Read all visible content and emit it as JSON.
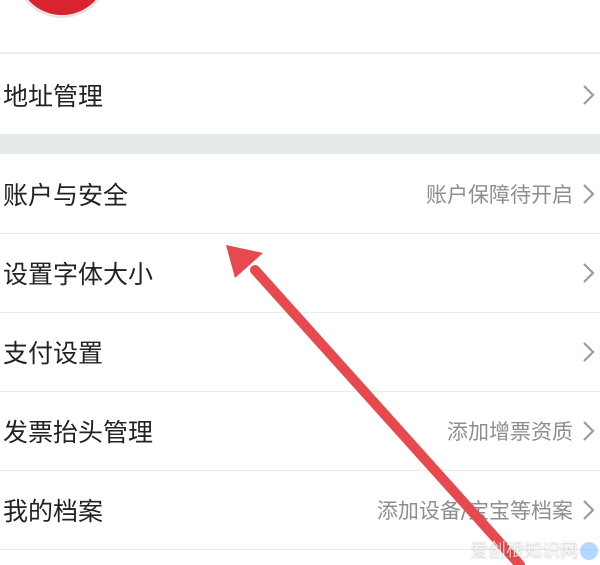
{
  "colors": {
    "accent_arrow": "#e64a4f",
    "section_gap": "#e6ebe8",
    "label_text": "#222222",
    "value_text": "#8e8e8e"
  },
  "settings": {
    "rows": [
      {
        "label": "地址管理",
        "value": ""
      },
      {
        "label": "账户与安全",
        "value": "账户保障待开启"
      },
      {
        "label": "设置字体大小",
        "value": ""
      },
      {
        "label": "支付设置",
        "value": ""
      },
      {
        "label": "发票抬头管理",
        "value": "添加增票资质"
      },
      {
        "label": "我的档案",
        "value": "添加设备/宝宝等档案"
      }
    ]
  },
  "icons": {
    "row_chevron": "chevron-right-icon",
    "annotation": "red-arrow-icon"
  },
  "watermark": {
    "text": "爱创根知识网"
  }
}
